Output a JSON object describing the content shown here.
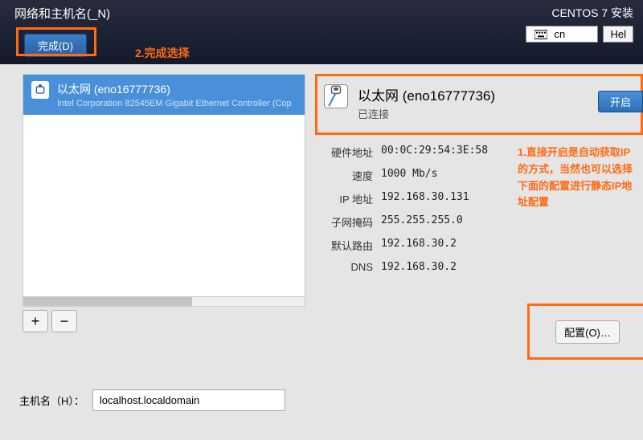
{
  "header": {
    "title": "网络和主机名(_N)",
    "install_label": "CENTOS 7 安装",
    "lang_indicator": "cn",
    "help_label": "Hel",
    "done_label": "完成(D)"
  },
  "annotations": {
    "step2": "2.完成选择",
    "step1": "1.直接开启是自动获取IP的方式，当然也可以选择下面的配置进行静态IP地址配置"
  },
  "nic_list": {
    "items": [
      {
        "name": "以太网 (eno16777736)",
        "desc": "Intel Corporation 82545EM Gigabit Ethernet Controller (Cop"
      }
    ]
  },
  "buttons": {
    "add": "+",
    "remove": "−",
    "on": "开启",
    "configure": "配置(O)…"
  },
  "detail": {
    "title": "以太网 (eno16777736)",
    "status": "已连接",
    "rows": {
      "hwaddr_label": "硬件地址",
      "hwaddr": "00:0C:29:54:3E:58",
      "speed_label": "速度",
      "speed": "1000 Mb/s",
      "ip_label": "IP 地址",
      "ip": "192.168.30.131",
      "mask_label": "子网掩码",
      "mask": "255.255.255.0",
      "gw_label": "默认路由",
      "gw": "192.168.30.2",
      "dns_label": "DNS",
      "dns": "192.168.30.2"
    }
  },
  "hostname": {
    "label": "主机名（H）：",
    "value": "localhost.localdomain"
  }
}
